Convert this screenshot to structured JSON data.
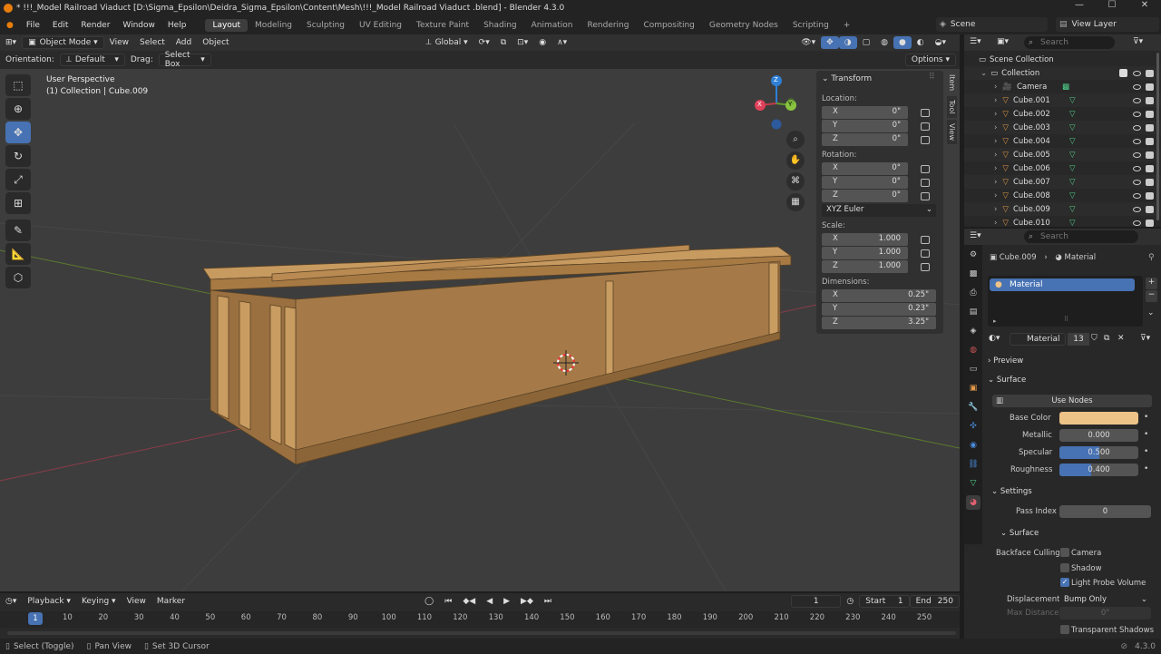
{
  "title": "* !!!_Model Railroad Viaduct  [D:\\Sigma_Epsilon\\Deidra_Sigma_Epsilon\\Content\\Mesh\\!!!_Model Railroad Viaduct .blend] - Blender 4.3.0",
  "menu": [
    "File",
    "Edit",
    "Render",
    "Window",
    "Help"
  ],
  "workspaces": [
    "Layout",
    "Modeling",
    "Sculpting",
    "UV Editing",
    "Texture Paint",
    "Shading",
    "Animation",
    "Rendering",
    "Compositing",
    "Geometry Nodes",
    "Scripting"
  ],
  "scene": "Scene",
  "view_layer": "View Layer",
  "viewport_header": {
    "mode": "Object Mode",
    "menus": [
      "View",
      "Select",
      "Add",
      "Object"
    ],
    "transform": "Global"
  },
  "tool_header": {
    "orientation_label": "Orientation:",
    "orientation": "Default",
    "drag_label": "Drag:",
    "drag": "Select Box",
    "options": "Options"
  },
  "viewport": {
    "perspective": "User Perspective",
    "context": "(1) Collection | Cube.009",
    "gizmo": {
      "x": "X",
      "y": "Y",
      "z": "Z"
    }
  },
  "npanel": {
    "title": "Transform",
    "location_label": "Location:",
    "location": [
      [
        "X",
        "0\""
      ],
      [
        "Y",
        "0\""
      ],
      [
        "Z",
        "0\""
      ]
    ],
    "rotation_label": "Rotation:",
    "rotation": [
      [
        "X",
        "0°"
      ],
      [
        "Y",
        "0°"
      ],
      [
        "Z",
        "0°"
      ]
    ],
    "euler": "XYZ Euler",
    "scale_label": "Scale:",
    "scale": [
      [
        "X",
        "1.000"
      ],
      [
        "Y",
        "1.000"
      ],
      [
        "Z",
        "1.000"
      ]
    ],
    "dimensions_label": "Dimensions:",
    "dimensions": [
      [
        "X",
        "0.25\""
      ],
      [
        "Y",
        "0.23\""
      ],
      [
        "Z",
        "3.25\""
      ]
    ],
    "tabs": [
      "Item",
      "Tool",
      "View"
    ]
  },
  "timeline": {
    "menus": [
      "Playback",
      "Keying",
      "View",
      "Marker"
    ],
    "current_frame": "1",
    "start_label": "Start",
    "start": "1",
    "end_label": "End",
    "end": "250",
    "ticks": [
      "1",
      "10",
      "20",
      "30",
      "40",
      "50",
      "60",
      "70",
      "80",
      "90",
      "100",
      "110",
      "120",
      "130",
      "140",
      "150",
      "160",
      "170",
      "180",
      "190",
      "200",
      "210",
      "220",
      "230",
      "240",
      "250"
    ]
  },
  "statusbar": {
    "items": [
      "Select (Toggle)",
      "Pan View",
      "Set 3D Cursor"
    ],
    "version": "4.3.0"
  },
  "outliner": {
    "search_placeholder": "Search",
    "root": "Scene Collection",
    "collection": "Collection",
    "items": [
      "Camera",
      "Cube.001",
      "Cube.002",
      "Cube.003",
      "Cube.004",
      "Cube.005",
      "Cube.006",
      "Cube.007",
      "Cube.008",
      "Cube.009",
      "Cube.010"
    ]
  },
  "properties": {
    "search_placeholder": "Search",
    "breadcrumb_object": "Cube.009",
    "breadcrumb_material": "Material",
    "slot": "Material",
    "material_name": "Material",
    "users": "13",
    "preview": "Preview",
    "surface": "Surface",
    "use_nodes": "Use Nodes",
    "base_color_label": "Base Color",
    "base_color": "#eec387",
    "metallic_label": "Metallic",
    "metallic": "0.000",
    "specular_label": "Specular",
    "specular": "0.500",
    "roughness_label": "Roughness",
    "roughness": "0.400",
    "settings": "Settings",
    "pass_index_label": "Pass Index",
    "pass_index": "0",
    "surface_sub": "Surface",
    "backface_label": "Backface Culling",
    "camera": "Camera",
    "shadow": "Shadow",
    "light_probe": "Light Probe Volume",
    "displacement_label": "Displacement",
    "displacement": "Bump Only",
    "max_distance_label": "Max Distance",
    "max_distance": "0\"",
    "transparent_shadows": "Transparent Shadows"
  },
  "colors": {
    "accent": "#4772b3",
    "wood": "#a87f4c",
    "object_orange": "#e49a49"
  }
}
